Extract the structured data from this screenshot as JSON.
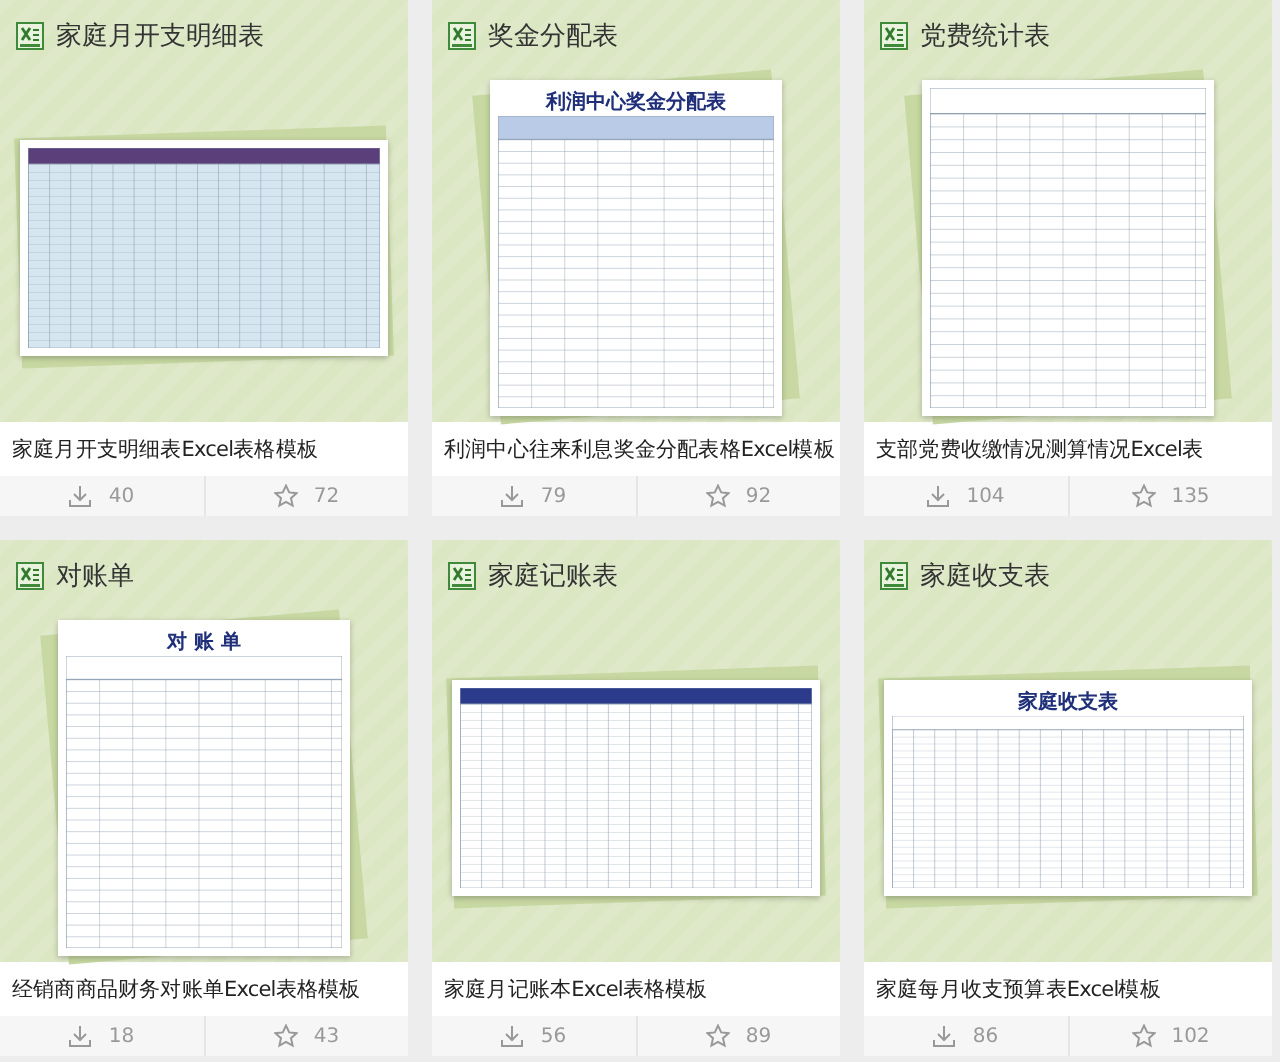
{
  "cards": [
    {
      "category": "家庭月开支明细表",
      "preview": {
        "kind": "banded"
      },
      "caption": "家庭月开支明细表Excel表格模板",
      "downloads": "40",
      "favorites": "72"
    },
    {
      "category": "奖金分配表",
      "preview": {
        "kind": "form",
        "title": "利润中心奖金分配表"
      },
      "caption": "利润中心往来利息奖金分配表格Excel模板",
      "downloads": "79",
      "favorites": "92"
    },
    {
      "category": "党费统计表",
      "preview": {
        "kind": "tall"
      },
      "caption": "支部党费收缴情况测算情况Excel表",
      "downloads": "104",
      "favorites": "135"
    },
    {
      "category": "对账单",
      "preview": {
        "kind": "tall",
        "title": "对 账 单"
      },
      "caption": "经销商商品财务对账单Excel表格模板",
      "downloads": "18",
      "favorites": "43"
    },
    {
      "category": "家庭记账表",
      "preview": {
        "kind": "ledger"
      },
      "caption": "家庭月记账本Excel表格模板",
      "downloads": "56",
      "favorites": "89"
    },
    {
      "category": "家庭收支表",
      "preview": {
        "kind": "wide",
        "title": "家庭收支表"
      },
      "caption": "家庭每月收支预算表Excel模板",
      "downloads": "86",
      "favorites": "102"
    }
  ]
}
